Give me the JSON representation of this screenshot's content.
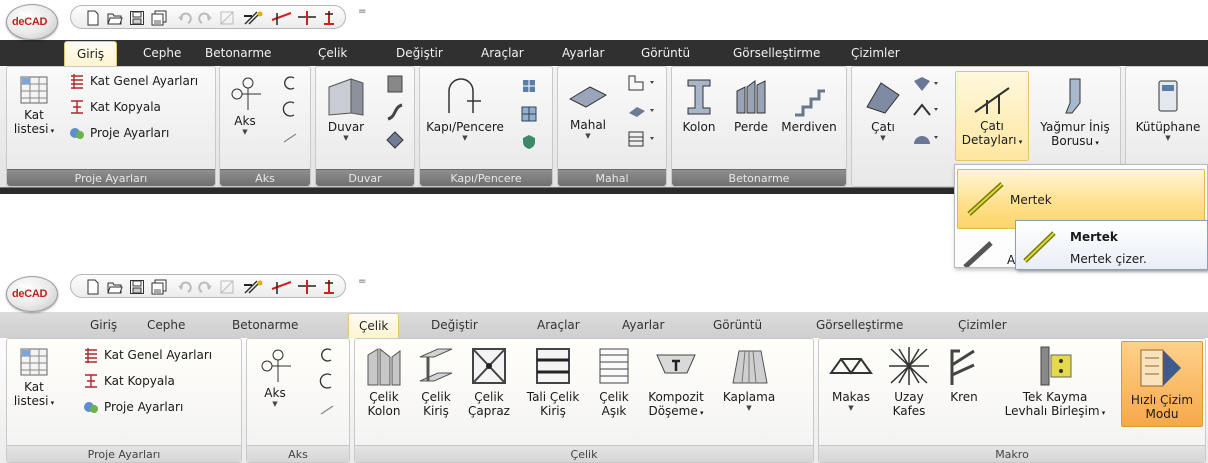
{
  "logo": "deCAD",
  "colors": {
    "accent": "#e8b84a",
    "logo_red": "#c2201f",
    "dark_tabbar": "#303030"
  },
  "quick_access": {
    "icons": [
      "new-file-icon",
      "open-file-icon",
      "save-icon",
      "save-all-icon",
      "undo-icon",
      "redo-icon",
      "window-icon",
      "magic-wand-icon",
      "line-axis-icon",
      "dimension-icon",
      "level-icon"
    ],
    "customize_glyph": "="
  },
  "ribbon_top": {
    "tabs": [
      "Giriş",
      "Cephe",
      "Betonarme",
      "Çelik",
      "Değiştir",
      "Araçlar",
      "Ayarlar",
      "Görüntü",
      "Görselleştirme",
      "Çizimler"
    ],
    "active_tab": "Giriş",
    "groups": {
      "proje": {
        "label": "Proje Ayarları",
        "kat_listesi": [
          "Kat",
          "listesi"
        ],
        "items": [
          "Kat Genel Ayarları",
          "Kat Kopyala",
          "Proje Ayarları"
        ]
      },
      "aks": {
        "label": "Aks",
        "button": "Aks"
      },
      "duvar": {
        "label": "Duvar",
        "button": "Duvar"
      },
      "kapi": {
        "label": "Kapı/Pencere",
        "button": "Kapı/Pencere"
      },
      "mahal": {
        "label": "Mahal",
        "button": "Mahal"
      },
      "betonarme": {
        "label": "Betonarme",
        "buttons": [
          "Kolon",
          "Perde",
          "Merdiven"
        ]
      },
      "cati": {
        "buttons": [
          "Çatı",
          "Çatı",
          "Detayları",
          "Yağmur İniş",
          "Borusu",
          "Kütüphane"
        ]
      }
    },
    "dropdown": {
      "item": "Mertek",
      "second_item_prefix": "A"
    },
    "tooltip": {
      "title": "Mertek",
      "description": "Mertek çizer."
    }
  },
  "ribbon_bottom": {
    "tabs": [
      "Giriş",
      "Cephe",
      "Betonarme",
      "Çelik",
      "Değiştir",
      "Araçlar",
      "Ayarlar",
      "Görüntü",
      "Görselleştirme",
      "Çizimler"
    ],
    "active_tab": "Çelik",
    "groups": {
      "proje": {
        "label": "Proje Ayarları",
        "kat_listesi": [
          "Kat",
          "listesi"
        ],
        "items": [
          "Kat Genel Ayarları",
          "Kat Kopyala",
          "Proje Ayarları"
        ]
      },
      "aks": {
        "label": "Aks",
        "button": "Aks"
      },
      "celik": {
        "label": "Çelik",
        "buttons": [
          [
            "Çelik",
            "Kolon"
          ],
          [
            "Çelik",
            "Kiriş"
          ],
          [
            "Çelik",
            "Çapraz"
          ],
          [
            "Tali Çelik",
            "Kiriş"
          ],
          [
            "Çelik",
            "Aşık"
          ],
          [
            "Kompozit",
            "Döşeme"
          ],
          [
            "Kaplama",
            ""
          ]
        ]
      },
      "makro": {
        "label": "Makro",
        "buttons": [
          [
            "Makas",
            ""
          ],
          [
            "Uzay",
            "Kafes"
          ],
          [
            "Kren",
            ""
          ],
          [
            "Tek Kayma",
            "Levhalı Birleşim"
          ],
          [
            "Hızlı Çizim",
            "Modu"
          ]
        ]
      }
    }
  }
}
